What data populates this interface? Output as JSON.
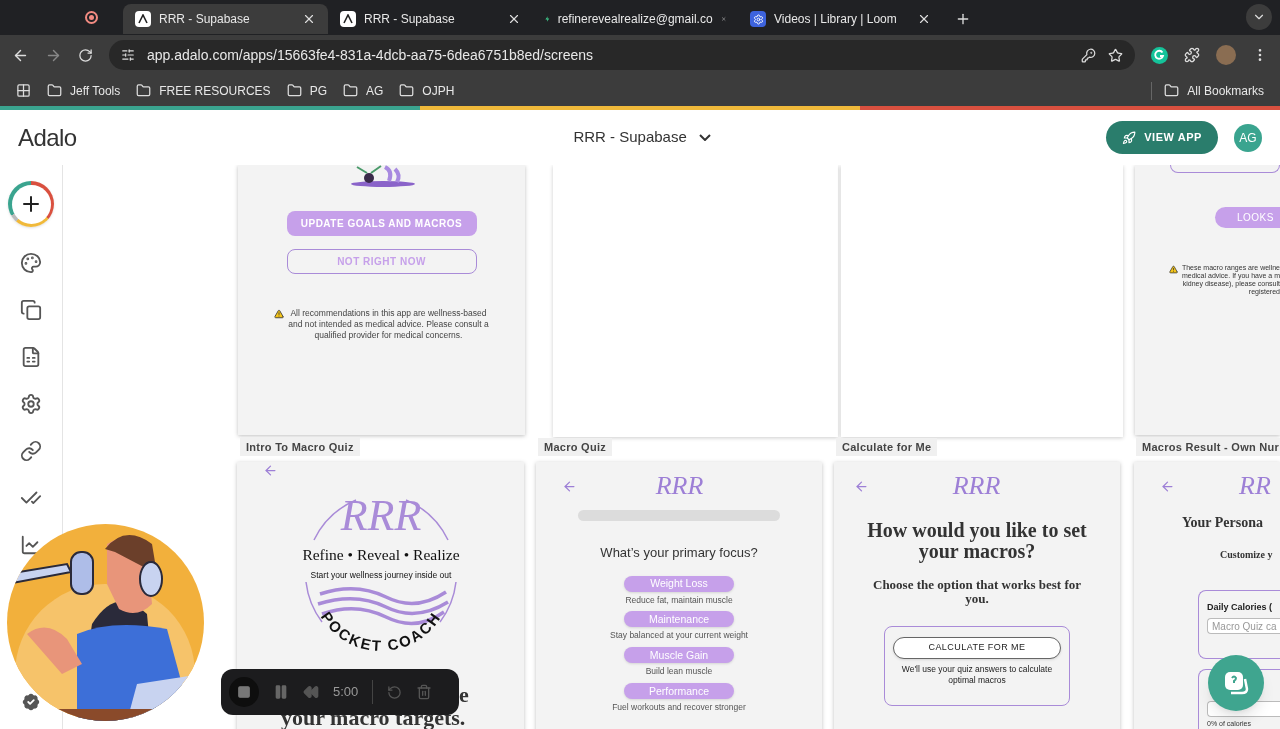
{
  "browser": {
    "tabs": [
      {
        "title": "RRR - Supabase",
        "selected": true
      },
      {
        "title": "RRR - Supabase",
        "selected": false
      },
      {
        "title": "refinerevealrealize@gmail.co",
        "selected": false
      },
      {
        "title": "Videos | Library | Loom",
        "selected": false
      }
    ],
    "url": "app.adalo.com/apps/15663fe4-831a-4dcb-aa75-6dea6751b8ed/screens",
    "bookmarks": [
      "Jeff Tools",
      "FREE RESOURCES",
      "PG",
      "AG",
      "OJPH"
    ],
    "all_bookmarks": "All Bookmarks"
  },
  "header": {
    "logo": "Adalo",
    "app_name": "RRR - Supabase",
    "view_app": "VIEW APP",
    "avatar": "AG"
  },
  "top_screens": [
    {
      "kind": "goals",
      "buttons": [
        {
          "label": "UPDATE GOALS AND MACROS",
          "kind": "filled"
        },
        {
          "label": "NOT RIGHT NOW",
          "kind": "outline"
        }
      ],
      "note": "All recommendations in this app are wellness-based\nand not intended as medical advice. Please consult a\nqualified provider for medical concerns."
    },
    {
      "kind": "blank"
    },
    {
      "kind": "blank"
    },
    {
      "kind": "results",
      "button": "LOOKS",
      "note": "These macro ranges are wellne\nmedical advice. If you have a m\nkidney disease), please consult\nregistered"
    }
  ],
  "bottom_screens": [
    {
      "label": "Intro To Macro Quiz",
      "kind": "intro",
      "logo": {
        "mark": "RRR",
        "tagline": "Refine • Reveal • Realize",
        "subtitle": "Start your wellness journey inside out",
        "arc": "POCKET COACH"
      },
      "heading_end": "e",
      "heading_line": "your macro targets."
    },
    {
      "label": "Macro Quiz",
      "kind": "quiz",
      "logo": "RRR",
      "progress": {
        "level": 0
      },
      "question": "What’s your primary focus?",
      "options": [
        {
          "label": "Weight Loss",
          "description": "Reduce fat, maintain muscle"
        },
        {
          "label": "Maintenance",
          "description": "Stay balanced at your current weight"
        },
        {
          "label": "Muscle Gain",
          "description": "Build lean muscle"
        },
        {
          "label": "Performance",
          "description": "Fuel workouts and recover stronger"
        }
      ]
    },
    {
      "label": "Calculate for Me",
      "kind": "choose",
      "logo": "RRR",
      "heading": "How would you like to set your macros?",
      "subheading": "Choose the option that works best for you.",
      "option": {
        "button": "CALCULATE FOR ME",
        "description": "We'll use your quiz answers to calculate optimal macros"
      }
    },
    {
      "label": "Macros Result - Own Nur",
      "kind": "result",
      "logo": "RR",
      "heading": "Your Persona",
      "subheading": "Customize y",
      "fields": [
        {
          "label": "Daily Calories (",
          "placeholder": "Macro Quiz ca"
        },
        {
          "note": "0% of calories"
        }
      ]
    }
  ],
  "recorder": {
    "time": "5:00"
  }
}
